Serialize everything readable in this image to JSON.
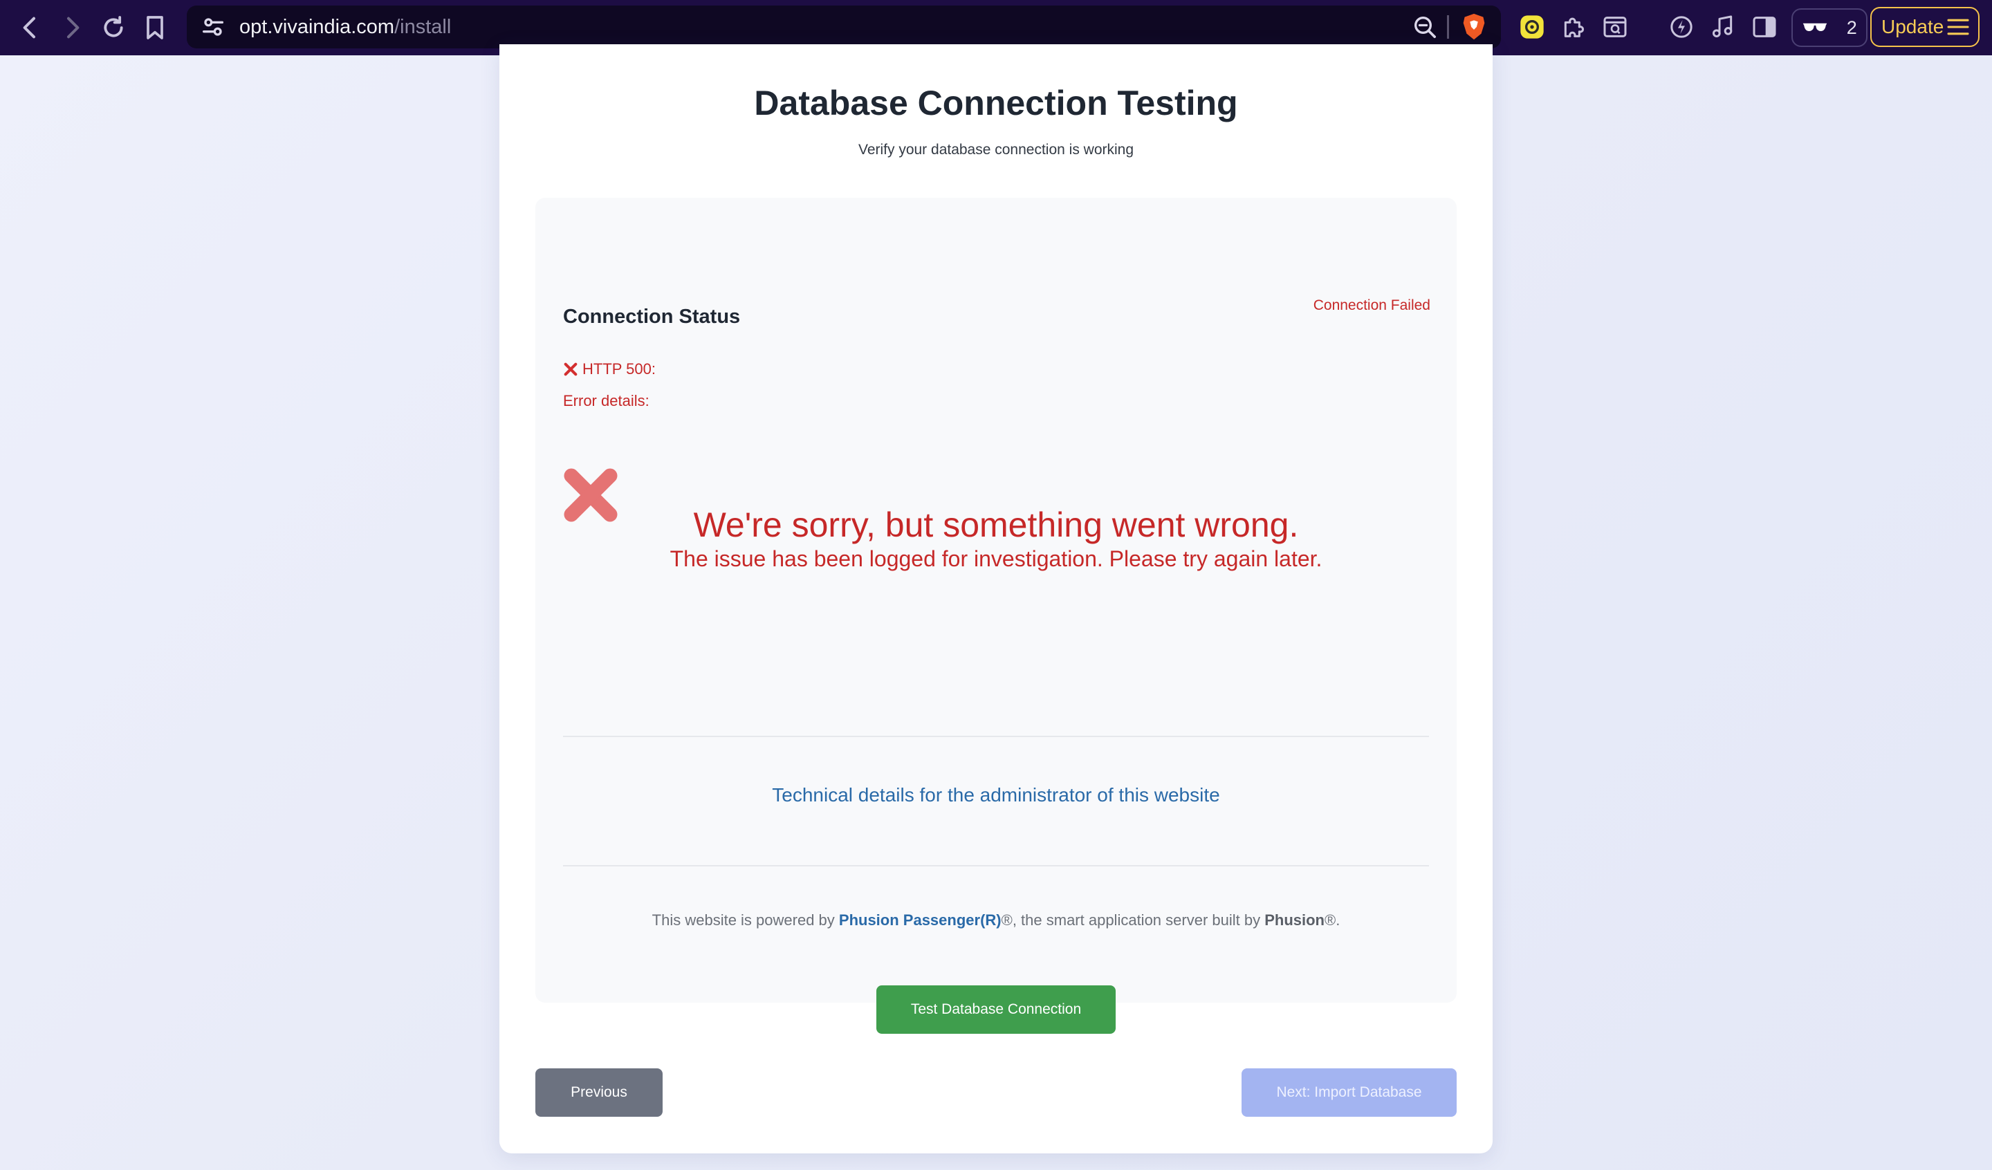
{
  "browser": {
    "url_host": "opt.vivaindia.com",
    "url_path": "/install",
    "vpn_count": "2",
    "update_label": "Update"
  },
  "page": {
    "title": "Database Connection Testing",
    "subtitle": "Verify your database connection is working"
  },
  "status": {
    "heading": "Connection Status",
    "badge": "Connection Failed",
    "http_error": "HTTP 500:",
    "error_details_label": "Error details:"
  },
  "error_page": {
    "headline": "We're sorry, but something went wrong.",
    "subline": "The issue has been logged for investigation. Please try again later.",
    "tech_link": "Technical details for the administrator of this website",
    "powered_prefix": "This website is powered by ",
    "powered_link": "Phusion Passenger(R)",
    "powered_middle": "®, the smart application server built by ",
    "powered_company": "Phusion",
    "powered_suffix": "®."
  },
  "actions": {
    "test_button": "Test Database Connection",
    "previous_button": "Previous",
    "next_button": "Next: Import Database"
  },
  "colors": {
    "error_red": "#c62828",
    "success_green": "#3f9e4d",
    "toolbar_bg": "#1d0d44",
    "next_disabled": "#a3b4f1"
  }
}
